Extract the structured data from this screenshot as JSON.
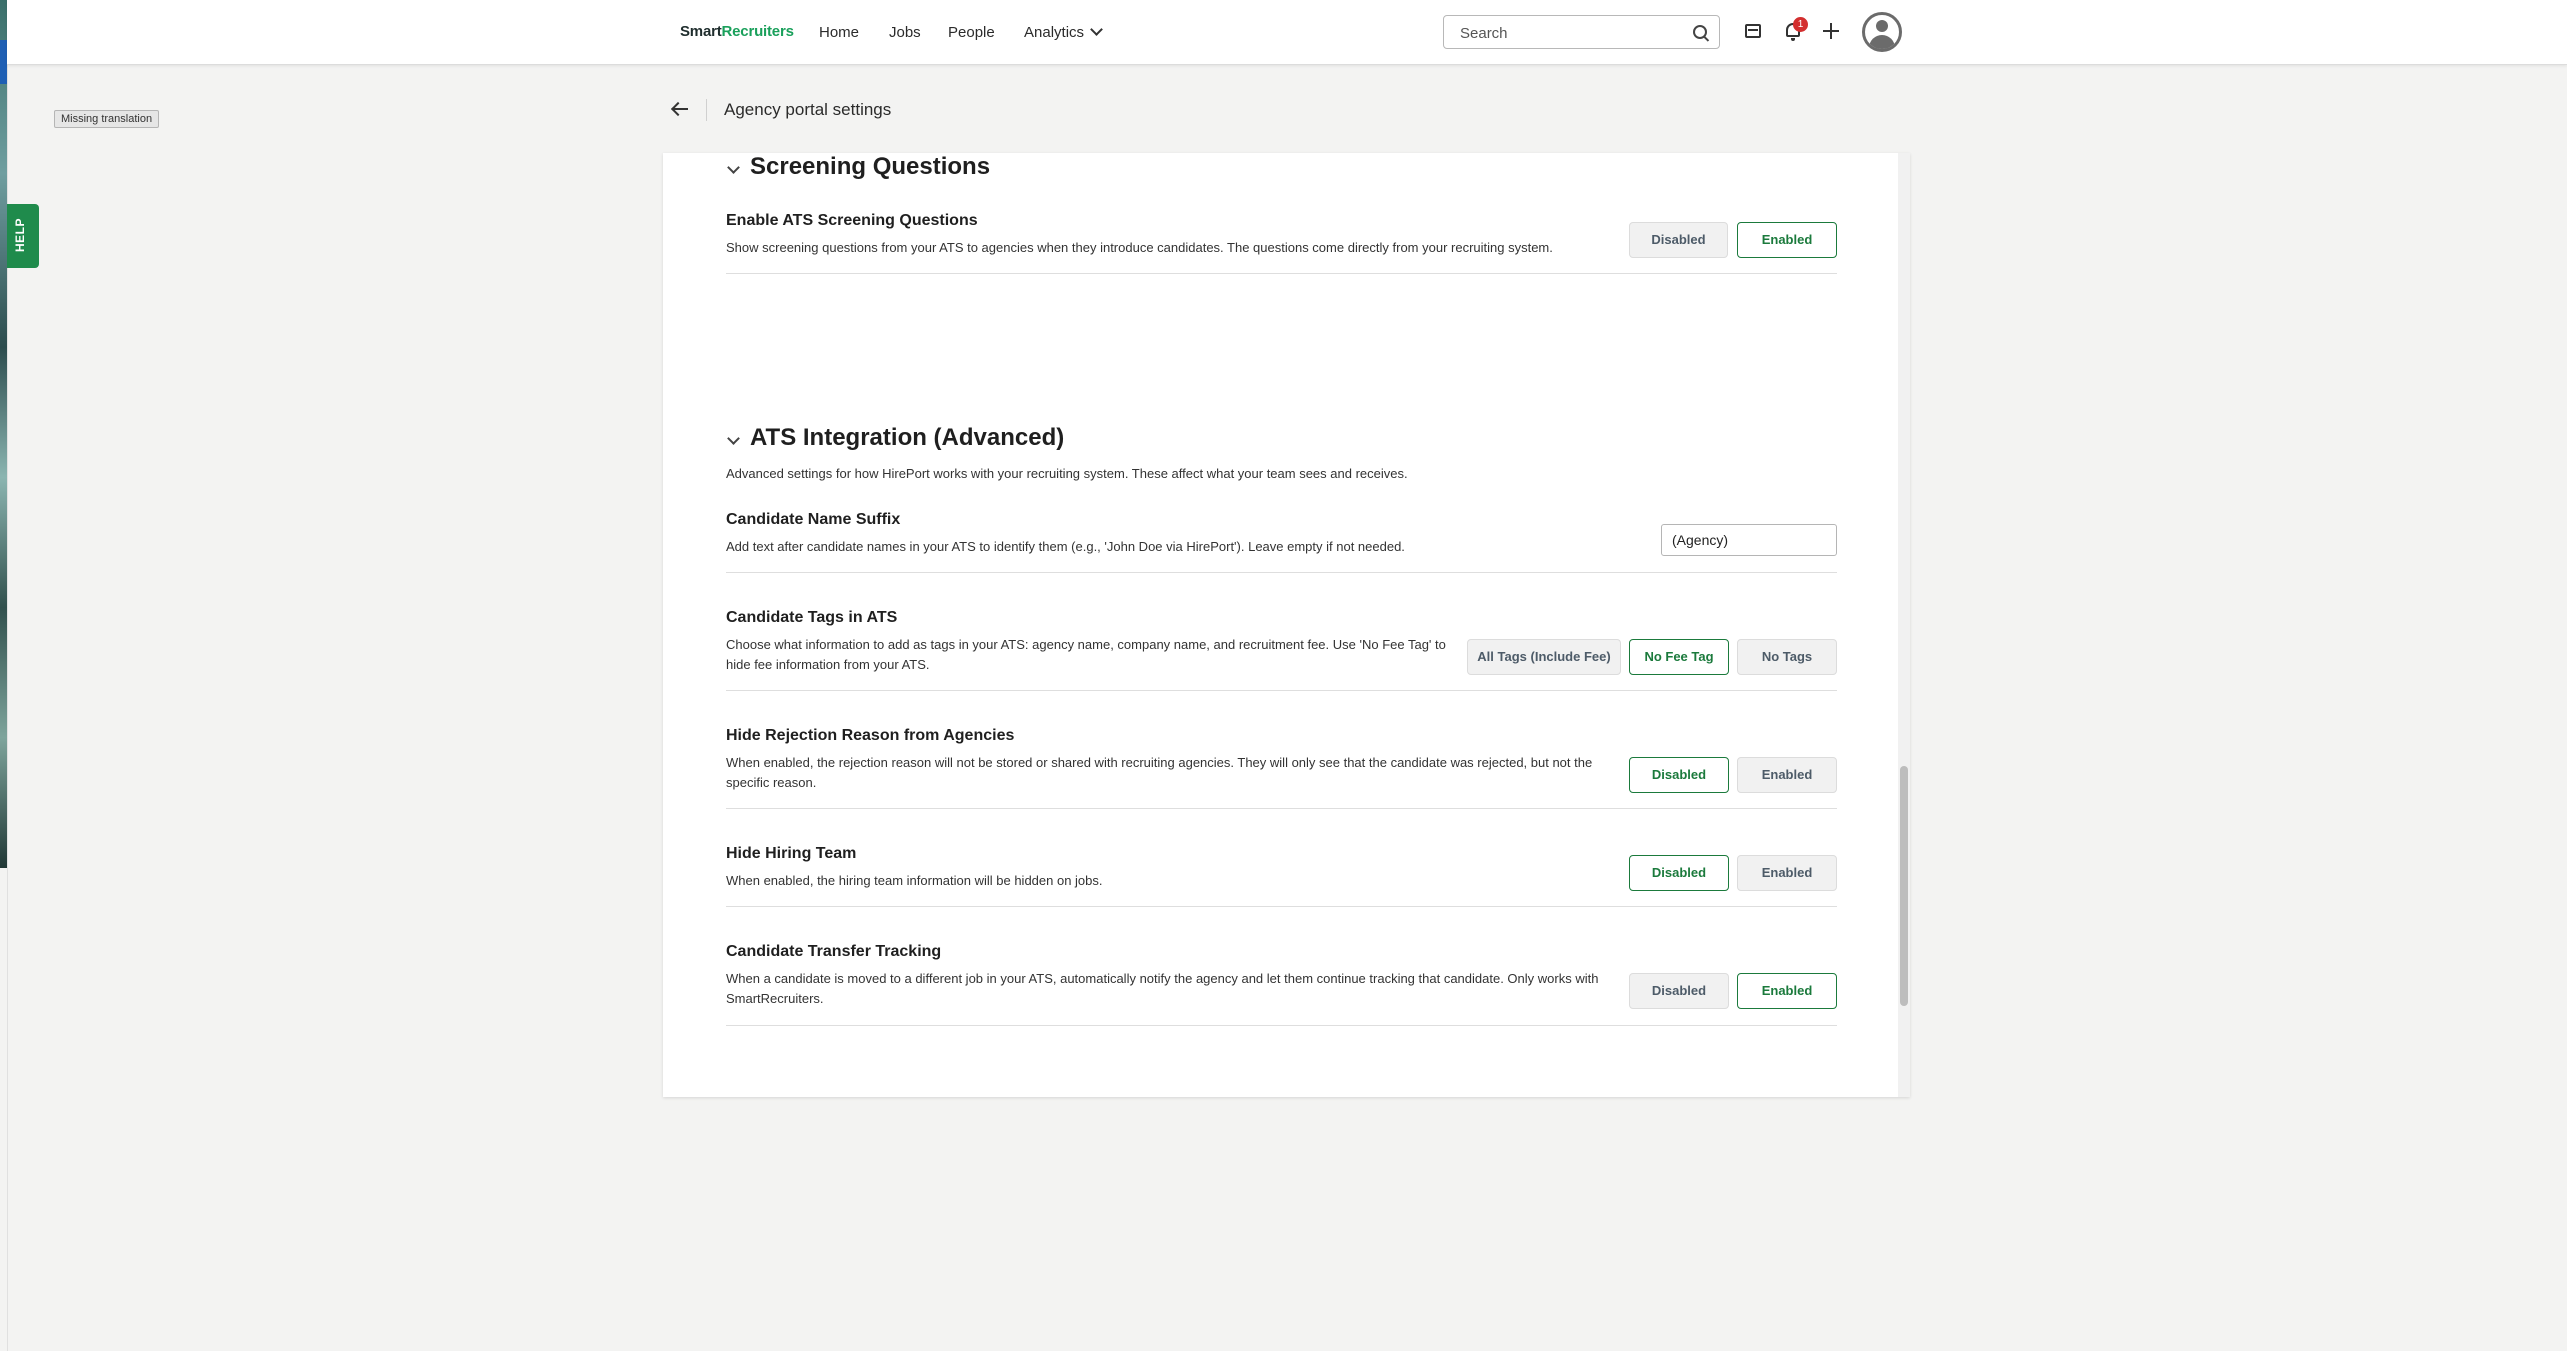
{
  "nav": {
    "brand_part1": "Smart",
    "brand_part2": "Recruiters",
    "items": [
      "Home",
      "Jobs",
      "People",
      "Analytics"
    ],
    "search_placeholder": "Search",
    "notification_count": "1"
  },
  "missing_translation": "Missing translation",
  "help_label": "HELP",
  "page_title": "Agency portal settings",
  "sections": {
    "screening": {
      "title": "Screening Questions",
      "rows": [
        {
          "title": "Enable ATS Screening Questions",
          "desc": "Show screening questions from your ATS to agencies when they introduce candidates. The questions come directly from your recruiting system.",
          "options": [
            "Disabled",
            "Enabled"
          ],
          "selected": "Enabled"
        }
      ]
    },
    "ats": {
      "title": "ATS Integration (Advanced)",
      "desc": "Advanced settings for how HirePort works with your recruiting system. These affect what your team sees and receives.",
      "suffix": {
        "title": "Candidate Name Suffix",
        "desc": "Add text after candidate names in your ATS to identify them (e.g., 'John Doe via HirePort'). Leave empty if not needed.",
        "value": "(Agency)"
      },
      "tags": {
        "title": "Candidate Tags in ATS",
        "desc": "Choose what information to add as tags in your ATS: agency name, company name, and recruitment fee. Use 'No Fee Tag' to hide fee information from your ATS.",
        "options": [
          "All Tags (Include Fee)",
          "No Fee Tag",
          "No Tags"
        ],
        "selected": "No Fee Tag"
      },
      "rejection": {
        "title": "Hide Rejection Reason from Agencies",
        "desc": "When enabled, the rejection reason will not be stored or shared with recruiting agencies. They will only see that the candidate was rejected, but not the specific reason.",
        "options": [
          "Disabled",
          "Enabled"
        ],
        "selected": "Disabled"
      },
      "hiring_team": {
        "title": "Hide Hiring Team",
        "desc": "When enabled, the hiring team information will be hidden on jobs.",
        "options": [
          "Disabled",
          "Enabled"
        ],
        "selected": "Disabled"
      },
      "transfer": {
        "title": "Candidate Transfer Tracking",
        "desc": "When a candidate is moved to a different job in your ATS, automatically notify the agency and let them continue tracking that candidate. Only works with SmartRecruiters.",
        "options": [
          "Disabled",
          "Enabled"
        ],
        "selected": "Enabled"
      }
    }
  }
}
